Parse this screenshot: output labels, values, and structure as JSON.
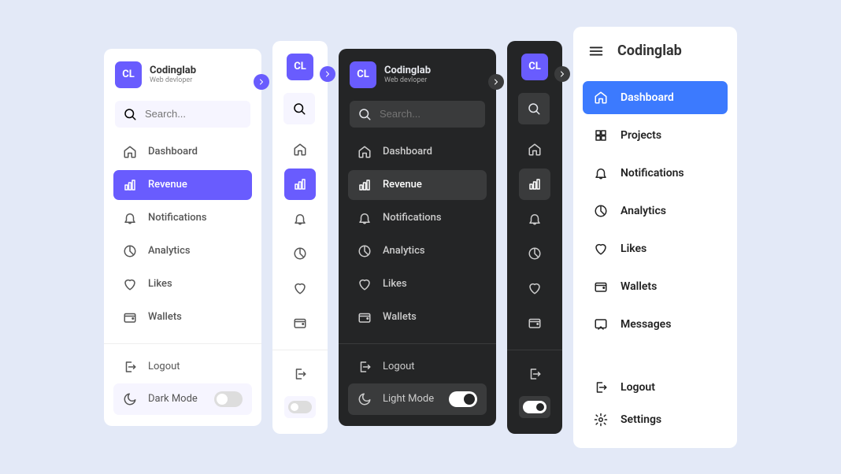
{
  "brand": {
    "name": "Codinglab",
    "subtitle": "Web devloper",
    "logo_text": "CL"
  },
  "search": {
    "placeholder": "Search..."
  },
  "panels_light_full": {
    "items": [
      {
        "icon": "home",
        "label": "Dashboard",
        "active": false
      },
      {
        "icon": "chart",
        "label": "Revenue",
        "active": true
      },
      {
        "icon": "bell",
        "label": "Notifications",
        "active": false
      },
      {
        "icon": "pie",
        "label": "Analytics",
        "active": false
      },
      {
        "icon": "heart",
        "label": "Likes",
        "active": false
      },
      {
        "icon": "wallet",
        "label": "Wallets",
        "active": false
      }
    ],
    "footer": {
      "logout": "Logout",
      "mode": "Dark Mode"
    }
  },
  "panels_dark_full": {
    "items": [
      {
        "icon": "home",
        "label": "Dashboard",
        "active": false
      },
      {
        "icon": "chart",
        "label": "Revenue",
        "active": true
      },
      {
        "icon": "bell",
        "label": "Notifications",
        "active": false
      },
      {
        "icon": "pie",
        "label": "Analytics",
        "active": false
      },
      {
        "icon": "heart",
        "label": "Likes",
        "active": false
      },
      {
        "icon": "wallet",
        "label": "Wallets",
        "active": false
      }
    ],
    "footer": {
      "logout": "Logout",
      "mode": "Light Mode"
    }
  },
  "panel5": {
    "items": [
      {
        "icon": "home",
        "label": "Dashboard",
        "active": true
      },
      {
        "icon": "grid",
        "label": "Projects",
        "active": false
      },
      {
        "icon": "bell",
        "label": "Notifications",
        "active": false
      },
      {
        "icon": "pie",
        "label": "Analytics",
        "active": false
      },
      {
        "icon": "heart",
        "label": "Likes",
        "active": false
      },
      {
        "icon": "wallet",
        "label": "Wallets",
        "active": false
      },
      {
        "icon": "message",
        "label": "Messages",
        "active": false
      }
    ],
    "footer": {
      "logout": "Logout",
      "settings": "Settings"
    }
  }
}
